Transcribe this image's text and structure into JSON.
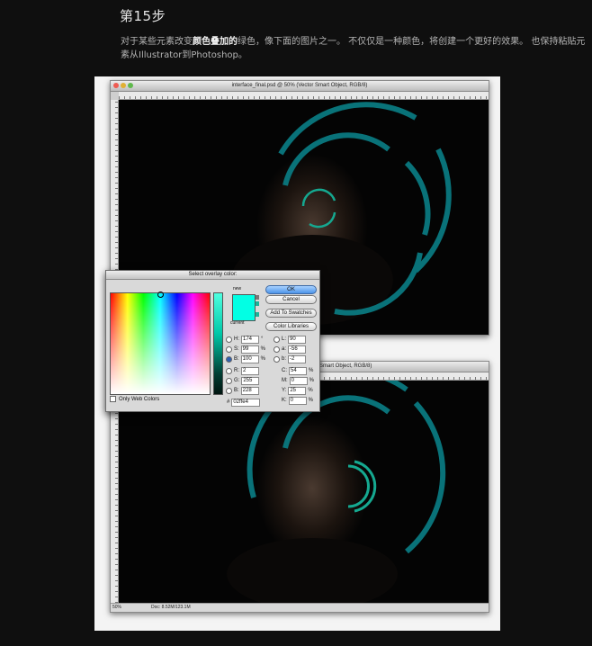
{
  "step_title": "第15步",
  "paragraph": {
    "part1": "对于某些元素改变",
    "bold": "颜色叠加的",
    "part2": "绿色，像下面的图片之一。 不仅仅是一种颜色，将创建一个更好的效果。 也保持粘贴元素从Illustrator到Photoshop。"
  },
  "window1": {
    "title": "interface_final.psd @ 50% (Vector Smart Object, RGB/8)"
  },
  "window2": {
    "title": "Smart Object, RGB/8)",
    "zoom": "50%",
    "doc": "Doc: 8.52M/123.1M"
  },
  "dialog": {
    "title": "Select overlay color:",
    "new_label": "new",
    "current_label": "current",
    "ok": "OK",
    "cancel": "Cancel",
    "add_swatches": "Add To Swatches",
    "color_libraries": "Color Libraries",
    "only_web_colors": "Only Web Colors",
    "hsb": [
      {
        "label": "H:",
        "value": "174",
        "unit": "°"
      },
      {
        "label": "S:",
        "value": "99",
        "unit": "%"
      },
      {
        "label": "B:",
        "value": "100",
        "unit": "%"
      }
    ],
    "rgb": [
      {
        "label": "R:",
        "value": "2"
      },
      {
        "label": "G:",
        "value": "255"
      },
      {
        "label": "B:",
        "value": "228"
      }
    ],
    "lab": [
      {
        "label": "L:",
        "value": "90"
      },
      {
        "label": "a:",
        "value": "-56"
      },
      {
        "label": "b:",
        "value": "-2"
      }
    ],
    "cmyk": [
      {
        "label": "C:",
        "value": "54",
        "unit": "%"
      },
      {
        "label": "M:",
        "value": "0",
        "unit": "%"
      },
      {
        "label": "Y:",
        "value": "25",
        "unit": "%"
      },
      {
        "label": "K:",
        "value": "0",
        "unit": "%"
      }
    ],
    "hex_label": "#",
    "hex": "02ffe4"
  },
  "colors": {
    "overlay": "#02ffe4",
    "hud_ring": "#0a7f86",
    "page_bg": "#0f0f0f"
  },
  "icons": [
    "close-light-icon",
    "minimize-light-icon",
    "zoom-light-icon",
    "hud-ring-graphic"
  ]
}
